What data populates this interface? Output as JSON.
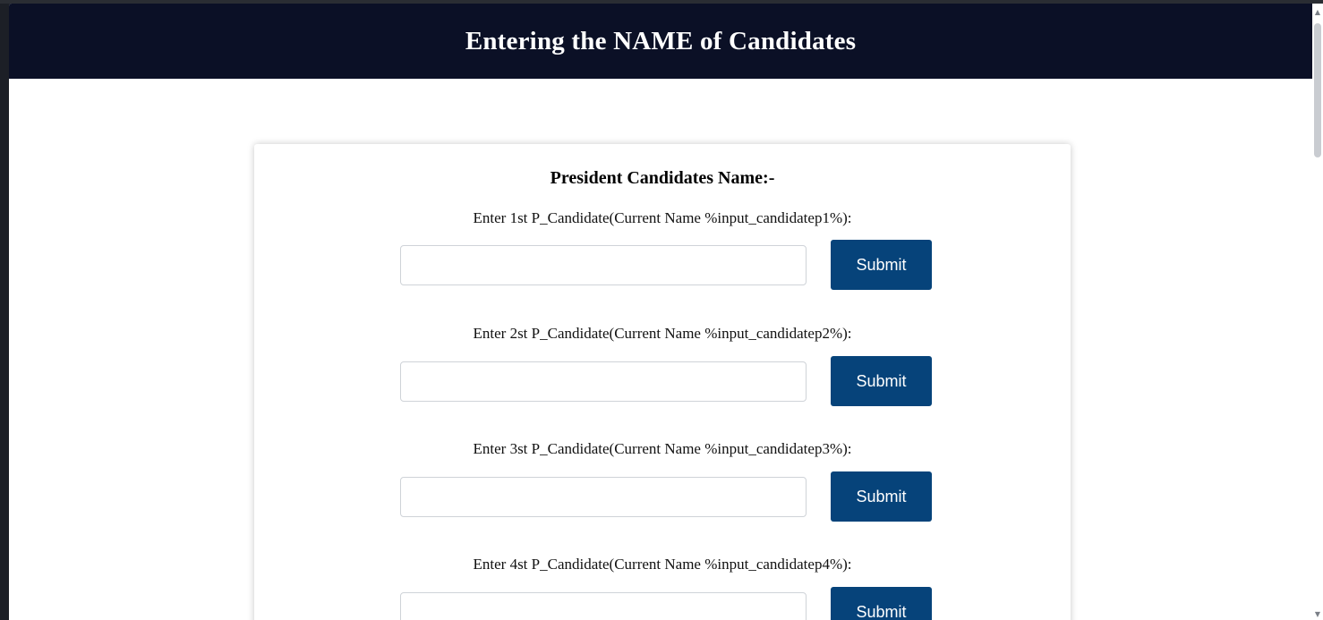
{
  "header": {
    "title": "Entering the NAME of Candidates"
  },
  "card": {
    "title": "President Candidates Name:-",
    "rows": [
      {
        "label": "Enter 1st P_Candidate(Current Name %input_candidatep1%):",
        "value": "",
        "button": "Submit"
      },
      {
        "label": "Enter 2st P_Candidate(Current Name %input_candidatep2%):",
        "value": "",
        "button": "Submit"
      },
      {
        "label": "Enter 3st P_Candidate(Current Name %input_candidatep3%):",
        "value": "",
        "button": "Submit"
      },
      {
        "label": "Enter 4st P_Candidate(Current Name %input_candidatep4%):",
        "value": "",
        "button": "Submit"
      }
    ]
  },
  "colors": {
    "header_bg": "#0b1026",
    "button_bg": "#06437a",
    "button_text": "#ffffff"
  },
  "scrollbar": {
    "up_icon": "chevron-up-icon",
    "down_icon": "chevron-down-icon"
  }
}
